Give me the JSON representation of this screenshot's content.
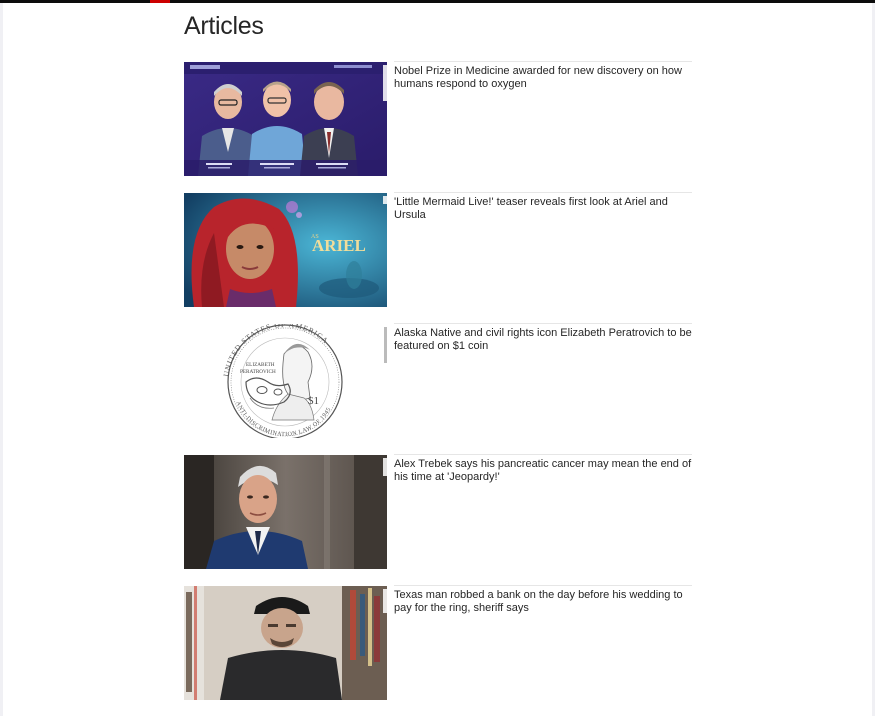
{
  "page": {
    "heading": "Articles"
  },
  "articles": [
    {
      "headline": "Nobel Prize in Medicine awarded for new discovery on how humans respond to oxygen",
      "image": "nobel-laureates-photo",
      "captions": [
        "Gregg L. Semenza",
        "Sir Peter J. Ratcliffe",
        "William G. Kaelin, Jr."
      ]
    },
    {
      "headline": "'Little Mermaid Live!' teaser reveals first look at Ariel and Ursula",
      "image": "ariel-promo-photo",
      "title_art": "ARIEL",
      "title_prefix": "AS"
    },
    {
      "headline": "Alaska Native and civil rights icon Elizabeth Peratrovich to be featured on $1 coin",
      "image": "coin-illustration",
      "coin": {
        "top_text": "UNITED STATES OF AMERICA",
        "bottom_text": "ANTI-DISCRIMINATION LAW OF 1945",
        "name_line1": "ELIZABETH",
        "name_line2": "PERATROVICH",
        "value": "$1"
      }
    },
    {
      "headline": "Alex Trebek says his pancreatic cancer may mean the end of his time at 'Jeopardy!'",
      "image": "alex-trebek-photo"
    },
    {
      "headline": "Texas man robbed a bank on the day before his wedding to pay for the ring, sheriff says",
      "image": "surveillance-photo"
    }
  ],
  "colors": {
    "top_bar": "#0c0c0c",
    "accent": "#cc0000",
    "text": "#262626",
    "rule": "#e6e6e6"
  }
}
